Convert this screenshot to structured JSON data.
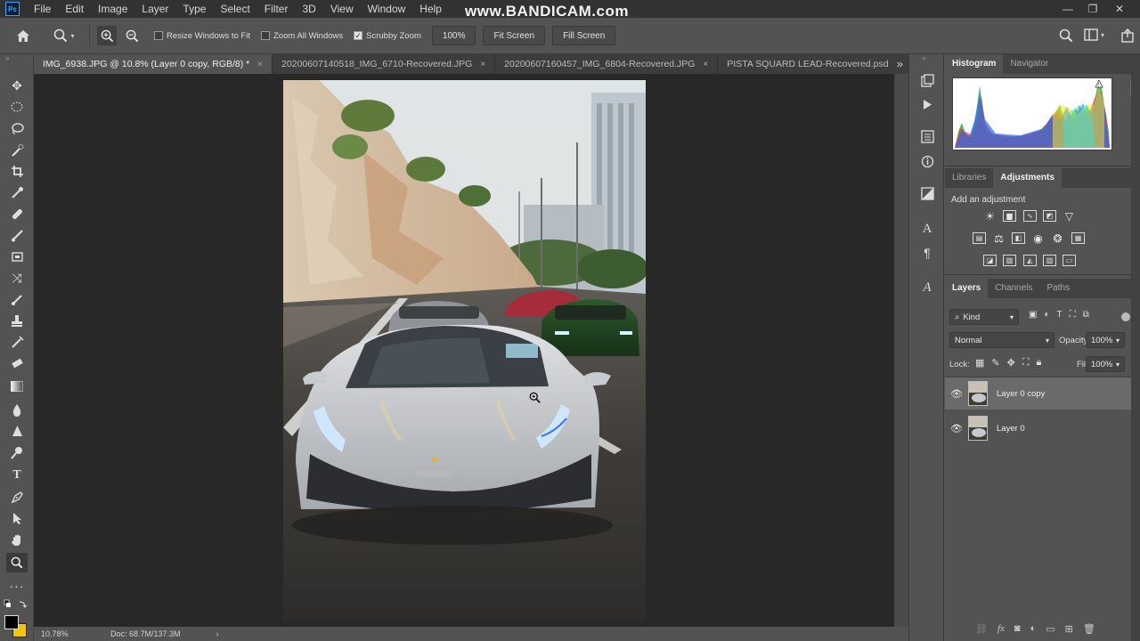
{
  "menu": {
    "logo": "Ps",
    "items": [
      "File",
      "Edit",
      "Image",
      "Layer",
      "Type",
      "Select",
      "Filter",
      "3D",
      "View",
      "Window",
      "Help"
    ],
    "watermark": "www.BANDICAM.com"
  },
  "options": {
    "resize_windows": "Resize Windows to Fit",
    "zoom_all": "Zoom All Windows",
    "scrubby_zoom": "Scrubby Zoom",
    "zoom_value": "100%",
    "fit_screen": "Fit Screen",
    "fill_screen": "Fill Screen"
  },
  "tabs": [
    {
      "label": "IMG_6938.JPG @ 10.8% (Layer 0 copy, RGB/8) *",
      "active": true
    },
    {
      "label": "20200607140518_IMG_6710-Recovered.JPG",
      "active": false
    },
    {
      "label": "20200607160457_IMG_6804-Recovered.JPG",
      "active": false
    },
    {
      "label": "PISTA SQUARD LEAD-Recovered.psd",
      "active": false
    }
  ],
  "tab_close": "×",
  "tab_overflow": "»",
  "status": {
    "zoom": "10.78%",
    "doc": "Doc: 68.7M/137.3M",
    "arrow": "›"
  },
  "panels": {
    "histogram_tabs": [
      "Histogram",
      "Navigator"
    ],
    "adjust_tabs": [
      "Libraries",
      "Adjustments"
    ],
    "add_adjustment": "Add an adjustment",
    "layers_tabs": [
      "Layers",
      "Channels",
      "Paths"
    ],
    "kind_label": "Kind",
    "blend_mode": "Normal",
    "opacity_label": "Opacity:",
    "opacity_value": "100%",
    "lock_label": "Lock:",
    "fill_label": "Fill:",
    "fill_value": "100%",
    "layers": [
      {
        "name": "Layer 0 copy",
        "selected": true
      },
      {
        "name": "Layer 0",
        "selected": false
      }
    ]
  }
}
